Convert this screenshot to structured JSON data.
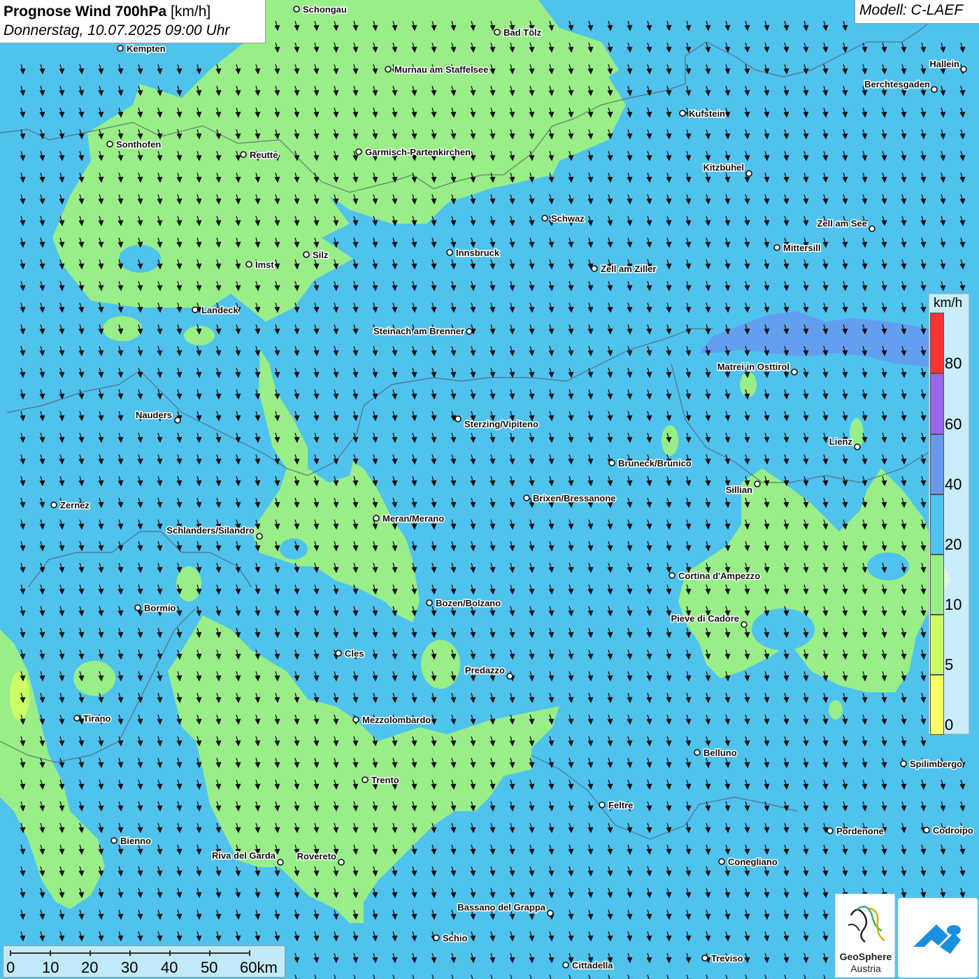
{
  "header": {
    "title_bold": "Prognose Wind 700hPa",
    "title_unit": "[km/h]",
    "datetime": "Donnerstag, 10.07.2025 09:00 Uhr",
    "model": "Modell: C-LAEF"
  },
  "colors": {
    "wind_0_5": "#ffff66",
    "wind_5_10": "#ccff66",
    "wind_10_20": "#99ee88",
    "wind_20_40": "#4fc3ee",
    "wind_40_60": "#6699ee",
    "wind_60_80": "#9966ee",
    "wind_80_plus": "#ff3333"
  },
  "legend": {
    "unit": "km/h",
    "ticks": [
      "80",
      "60",
      "40",
      "20",
      "10",
      "5",
      "0"
    ]
  },
  "scalebar": {
    "labels": [
      "0",
      "10",
      "20",
      "30",
      "40",
      "50",
      "60km"
    ]
  },
  "logos": {
    "geosphere_line1": "GeoSphere",
    "geosphere_line2": "Austria"
  },
  "cities": [
    {
      "name": "Schongau"
    },
    {
      "name": "Bad Tölz"
    },
    {
      "name": "Kempten"
    },
    {
      "name": "Murnau am Staffelsee"
    },
    {
      "name": "Hallein"
    },
    {
      "name": "Berchtesgaden"
    },
    {
      "name": "Kufstein"
    },
    {
      "name": "Sonthofen"
    },
    {
      "name": "Reutte"
    },
    {
      "name": "Garmisch-Partenkirchen"
    },
    {
      "name": "Kitzbühel"
    },
    {
      "name": "Schwaz"
    },
    {
      "name": "Zell am See"
    },
    {
      "name": "Mittersill"
    },
    {
      "name": "Innsbruck"
    },
    {
      "name": "Silz"
    },
    {
      "name": "Imst"
    },
    {
      "name": "Zell am Ziller"
    },
    {
      "name": "Landeck"
    },
    {
      "name": "Steinach am Brenner"
    },
    {
      "name": "Matrei in Osttirol"
    },
    {
      "name": "Nauders"
    },
    {
      "name": "Sterzing/Vipiteno"
    },
    {
      "name": "Lienz"
    },
    {
      "name": "Bruneck/Brunico"
    },
    {
      "name": "Sillian"
    },
    {
      "name": "Zernez"
    },
    {
      "name": "Brixen/Bressanone"
    },
    {
      "name": "Meran/Merano"
    },
    {
      "name": "Schlanders/Silandro"
    },
    {
      "name": "Cortina d'Ampezzo"
    },
    {
      "name": "Bormio"
    },
    {
      "name": "Bozen/Bolzano"
    },
    {
      "name": "Pieve di Cadore"
    },
    {
      "name": "Cles"
    },
    {
      "name": "Predazzo"
    },
    {
      "name": "Tirano"
    },
    {
      "name": "Mezzolombardo"
    },
    {
      "name": "Belluno"
    },
    {
      "name": "Spilimbergo"
    },
    {
      "name": "Trento"
    },
    {
      "name": "Feltre"
    },
    {
      "name": "Bienno"
    },
    {
      "name": "Pordenone"
    },
    {
      "name": "Codroipo"
    },
    {
      "name": "Riva del Garda"
    },
    {
      "name": "Rovereto"
    },
    {
      "name": "Conegliano"
    },
    {
      "name": "Bassano del Grappa"
    },
    {
      "name": "Schio"
    },
    {
      "name": "Treviso"
    },
    {
      "name": "Cittadella"
    }
  ]
}
